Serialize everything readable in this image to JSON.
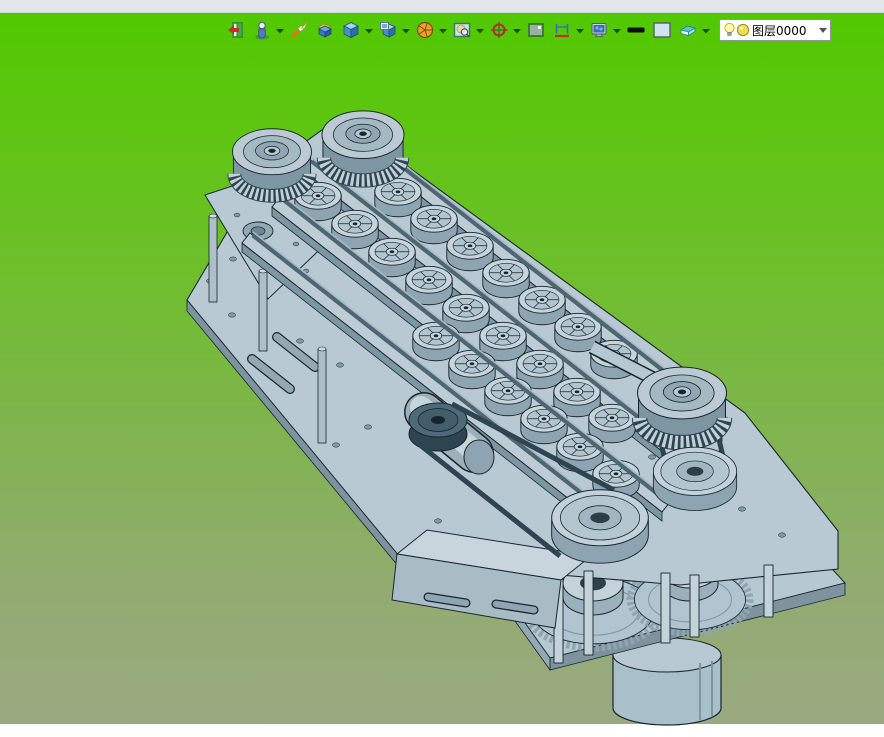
{
  "chrome": {
    "top_strip_color": "#e3e7ea"
  },
  "viewport": {
    "background_top": "#52c803",
    "background_bottom": "#9aa981"
  },
  "toolbar": {
    "items": [
      {
        "name": "exit-sketch",
        "icon": "exit-door-icon",
        "has_dropdown": false
      },
      {
        "name": "feature-figure",
        "icon": "figure-icon",
        "has_dropdown": true
      },
      {
        "name": "sketch-brush",
        "icon": "brush-icon",
        "has_dropdown": false
      },
      {
        "name": "extrude-box",
        "icon": "open-box-icon",
        "has_dropdown": false
      },
      {
        "name": "solid-cube",
        "icon": "cube-icon",
        "has_dropdown": true
      },
      {
        "name": "solid-preview",
        "icon": "cube-image-icon",
        "has_dropdown": true
      },
      {
        "name": "revolve-wheel",
        "icon": "pie-wheel-icon",
        "has_dropdown": true
      },
      {
        "name": "zoom-view",
        "icon": "image-magnifier-icon",
        "has_dropdown": true
      },
      {
        "name": "rotate-view",
        "icon": "rotate-compass-icon",
        "has_dropdown": true
      },
      {
        "name": "display-mode",
        "icon": "display-box-icon",
        "has_dropdown": false
      },
      {
        "name": "measure",
        "icon": "measure-icon",
        "has_dropdown": true
      },
      {
        "name": "render-monitor",
        "icon": "monitor-icon",
        "has_dropdown": true
      },
      {
        "name": "line-width",
        "icon": "line-width-icon",
        "has_dropdown": false
      },
      {
        "name": "color-swatch",
        "icon": "color-swatch-icon",
        "has_dropdown": false
      },
      {
        "name": "eraser",
        "icon": "eraser-icon",
        "has_dropdown": true
      }
    ],
    "layer_combo": {
      "value": "图层0000",
      "icons": [
        "bulb-icon",
        "layer-sphere-icon"
      ]
    }
  },
  "model": {
    "name": "dual-lane-roller-conveyor-assembly",
    "body_color": "#b9c9d3",
    "shade_color": "#8ea4b0",
    "outline_color": "#17262e"
  }
}
